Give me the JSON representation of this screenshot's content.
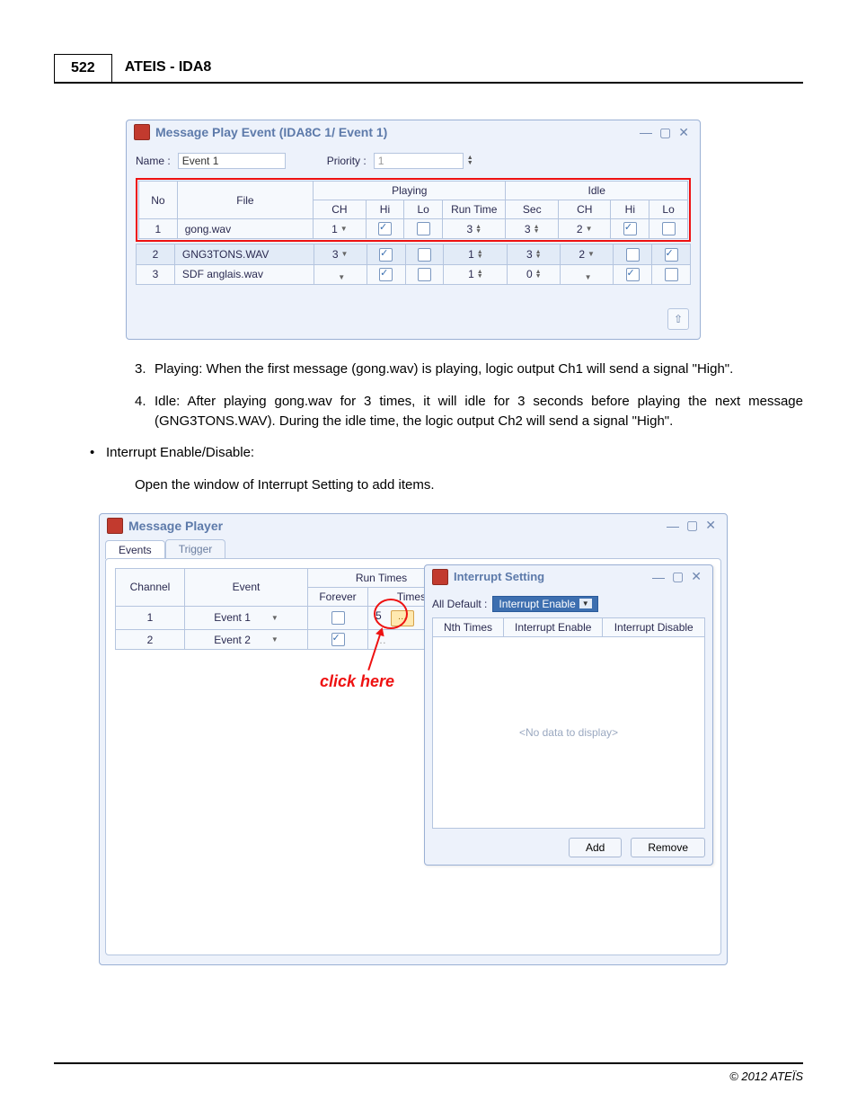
{
  "header": {
    "page_number": "522",
    "doc_title": "ATEIS - IDA8"
  },
  "win1": {
    "title": "Message Play Event (IDA8C 1/ Event 1)",
    "name_label": "Name :",
    "name_value": "Event 1",
    "priority_label": "Priority :",
    "priority_value": "1",
    "cols": {
      "no": "No",
      "file": "File",
      "playing": "Playing",
      "idle": "Idle",
      "ch": "CH",
      "hi": "Hi",
      "lo": "Lo",
      "runtime": "Run Time",
      "sec": "Sec"
    },
    "rows": [
      {
        "no": "1",
        "file": "gong.wav",
        "p_ch": "1",
        "p_hi": true,
        "p_lo": false,
        "runtime": "3",
        "sec": "3",
        "i_ch": "2",
        "i_hi": true,
        "i_lo": false
      },
      {
        "no": "2",
        "file": "GNG3TONS.WAV",
        "p_ch": "3",
        "p_hi": true,
        "p_lo": false,
        "runtime": "1",
        "sec": "3",
        "i_ch": "2",
        "i_hi": false,
        "i_lo": true
      },
      {
        "no": "3",
        "file": "SDF anglais.wav",
        "p_ch": "",
        "p_hi": true,
        "p_lo": false,
        "runtime": "1",
        "sec": "0",
        "i_ch": "",
        "i_hi": true,
        "i_lo": false
      }
    ]
  },
  "text": {
    "item3_num": "3.",
    "item3": "Playing: When the first message (gong.wav) is playing, logic output Ch1 will send a signal \"High\".",
    "item4_num": "4.",
    "item4": "Idle: After playing gong.wav for 3 times, it will idle for 3 seconds before playing the next message (GNG3TONS.WAV). During the idle time, the logic output Ch2 will send a signal \"High\".",
    "bullet": "Interrupt Enable/Disable:",
    "sub": "Open the window of Interrupt Setting to add items."
  },
  "win2": {
    "title": "Message Player",
    "tabs": {
      "events": "Events",
      "trigger": "Trigger"
    },
    "cols": {
      "channel": "Channel",
      "event": "Event",
      "runtimes": "Run Times",
      "forever": "Forever",
      "times": "Times"
    },
    "rows": [
      {
        "channel": "1",
        "event": "Event 1",
        "forever": false,
        "times": "5"
      },
      {
        "channel": "2",
        "event": "Event 2",
        "forever": true,
        "times": ""
      }
    ],
    "click_here": "click here"
  },
  "subwin": {
    "title": "Interrupt Setting",
    "all_default_label": "All Default :",
    "all_default_value": "Interrupt Enable",
    "cols": {
      "nth": "Nth Times",
      "en": "Interrupt Enable",
      "dis": "Interrupt Disable"
    },
    "empty": "<No data to display>",
    "add": "Add",
    "remove": "Remove"
  },
  "footer": {
    "copyright": "© 2012 ATEÏS"
  }
}
